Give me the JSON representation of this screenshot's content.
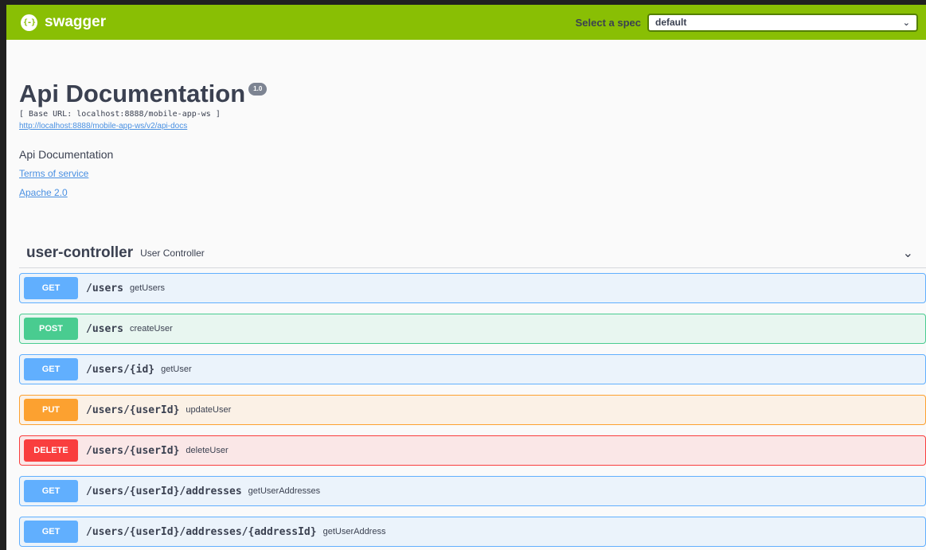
{
  "topbar": {
    "logo_icon": "{-}",
    "logo_text": "swagger",
    "select_label": "Select a spec",
    "select_value": "default",
    "select_chevron": "⌄"
  },
  "info": {
    "title": "Api Documentation",
    "version": "1.0",
    "base_url": "[ Base URL: localhost:8888/mobile-app-ws ]",
    "spec_url": "http://localhost:8888/mobile-app-ws/v2/api-docs",
    "description": "Api Documentation",
    "terms_link": "Terms of service",
    "license_link": "Apache 2.0"
  },
  "tag": {
    "name": "user-controller",
    "description": "User Controller",
    "toggle_icon": "⌄"
  },
  "operations": [
    {
      "method": "GET",
      "path": "/users",
      "summary": "getUsers"
    },
    {
      "method": "POST",
      "path": "/users",
      "summary": "createUser"
    },
    {
      "method": "GET",
      "path": "/users/{id}",
      "summary": "getUser"
    },
    {
      "method": "PUT",
      "path": "/users/{userId}",
      "summary": "updateUser"
    },
    {
      "method": "DELETE",
      "path": "/users/{userId}",
      "summary": "deleteUser"
    },
    {
      "method": "GET",
      "path": "/users/{userId}/addresses",
      "summary": "getUserAddresses"
    },
    {
      "method": "GET",
      "path": "/users/{userId}/addresses/{addressId}",
      "summary": "getUserAddress"
    }
  ],
  "colors": {
    "brand": "#89bf04",
    "get": "#61affe",
    "post": "#49cc90",
    "put": "#fca130",
    "delete": "#f93e3e",
    "text": "#3b4151"
  }
}
